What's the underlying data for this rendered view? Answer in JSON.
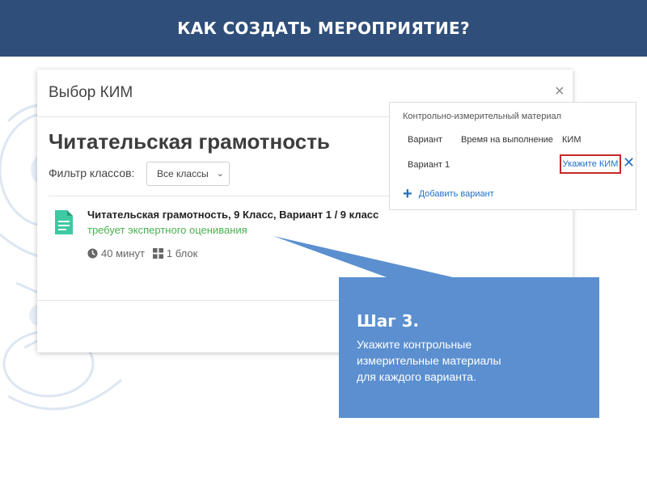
{
  "slide": {
    "title": "КАК СОЗДАТЬ МЕРОПРИЯТИЕ?"
  },
  "modal": {
    "title": "Выбор КИМ",
    "close_symbol": "×",
    "subject_title": "Читательская грамотность",
    "filter": {
      "label": "Фильтр классов:",
      "selected": "Все классы"
    },
    "item": {
      "title": "Читательская грамотность, 9 Класс, Вариант 1 / 9 класс",
      "status": "требует экспертного оценивания",
      "duration": "40 минут",
      "blocks": "1 блок",
      "status_color": "#4caf50"
    }
  },
  "kim_panel": {
    "title": "Контрольно-измерительный материал",
    "columns": [
      "Вариант",
      "Время на выполнение",
      "КИМ"
    ],
    "rows": [
      {
        "variant": "Вариант 1",
        "kim_link": "Укажите КИМ",
        "remove_symbol": "✕"
      }
    ],
    "add_variant": {
      "icon": "+",
      "label": "Добавить вариант"
    }
  },
  "callout": {
    "step": "Шаг 3.",
    "lines": [
      "Укажите контрольные",
      "измерительные материалы",
      "для каждого варианта."
    ]
  },
  "colors": {
    "header_bg": "#2f4f7a",
    "callout_bg": "#5b8fcf",
    "link": "#1f6fc7",
    "highlight_border": "#c62828",
    "doc_icon": "#3ec9a3"
  }
}
